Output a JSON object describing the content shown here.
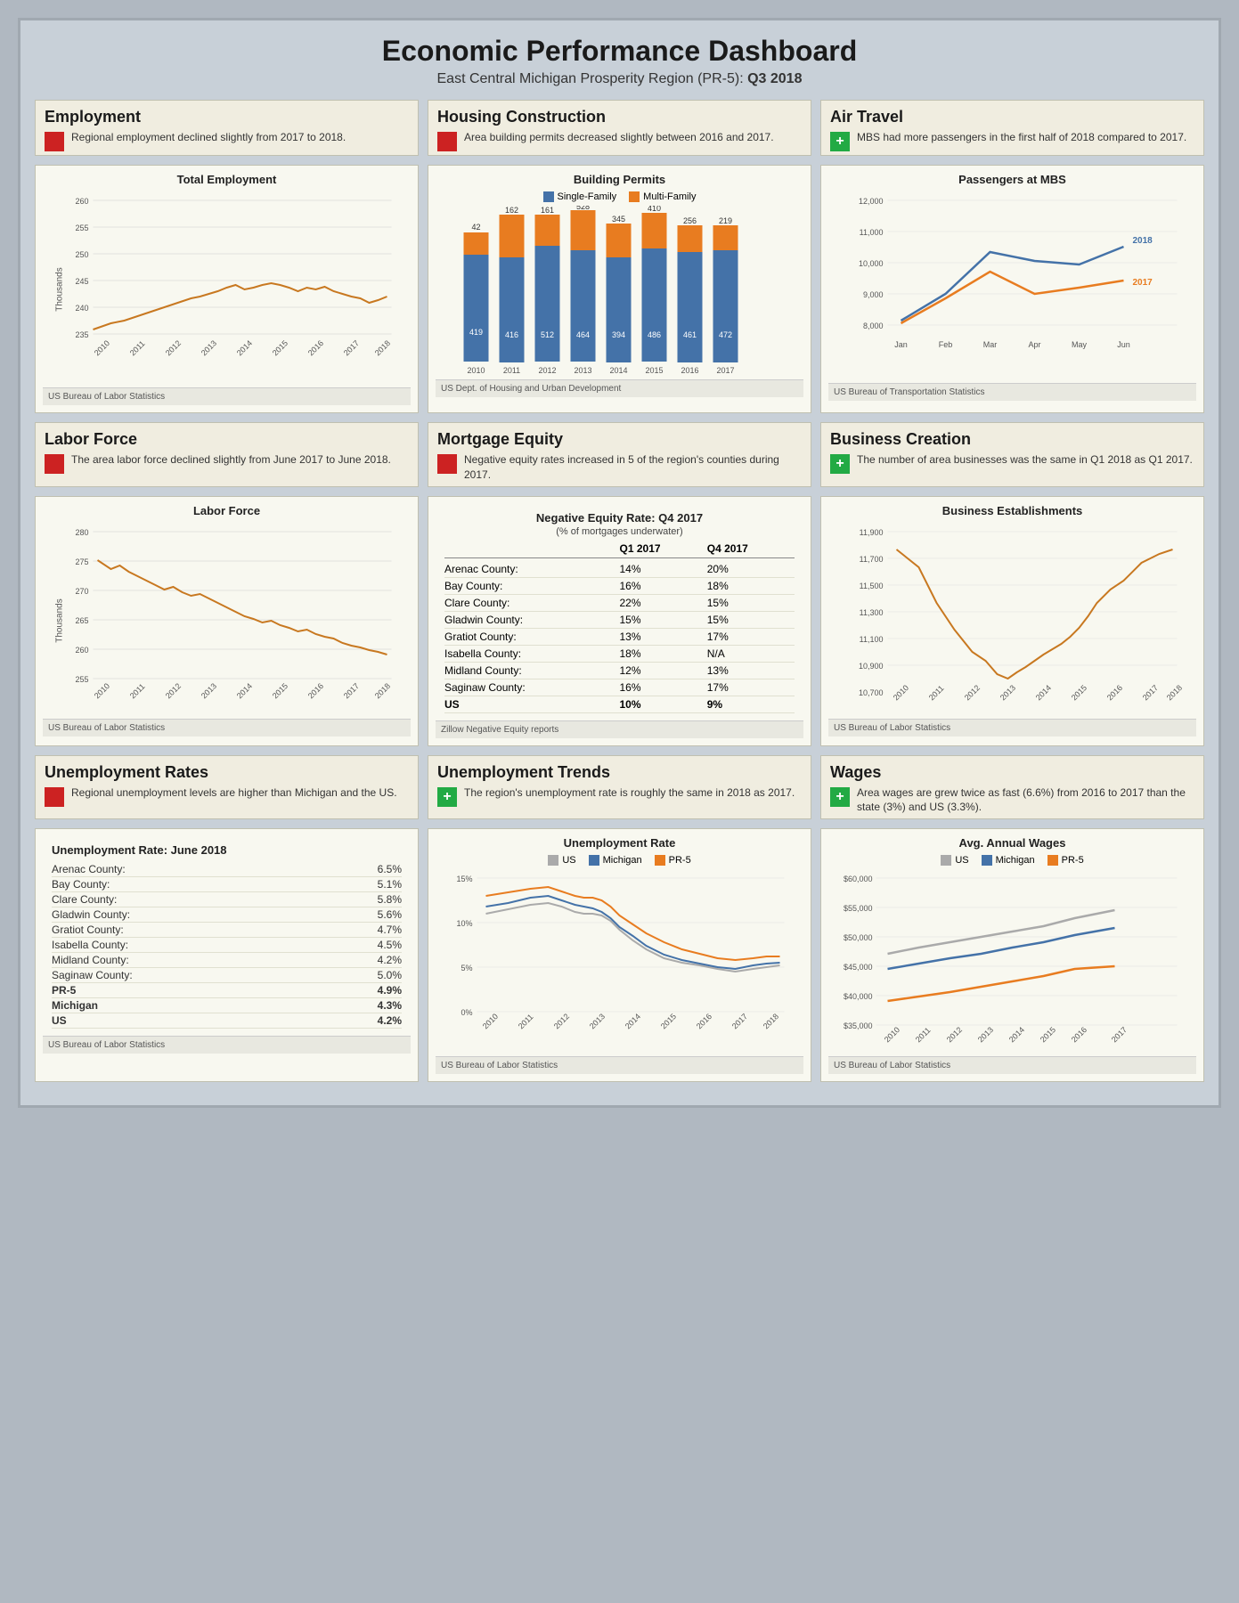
{
  "header": {
    "title": "Economic Performance Dashboard",
    "subtitle": "East Central Michigan Prosperity Region (PR-5):",
    "period": "Q3 2018"
  },
  "sections": {
    "employment": {
      "title": "Employment",
      "indicator": "red",
      "description": "Regional employment declined slightly from 2017 to 2018.",
      "chart_title": "Total Employment",
      "source": "US Bureau of Labor Statistics"
    },
    "housing": {
      "title": "Housing Construction",
      "indicator": "red",
      "description": "Area building permits decreased slightly between 2016 and 2017.",
      "chart_title": "Building Permits",
      "source": "US Dept. of Housing and Urban Development"
    },
    "air_travel": {
      "title": "Air Travel",
      "indicator": "green",
      "description": "MBS had more passengers in the first half of 2018 compared to 2017.",
      "chart_title": "Passengers at MBS",
      "source": "US Bureau of Transportation Statistics"
    },
    "labor_force": {
      "title": "Labor Force",
      "indicator": "red",
      "description": "The area labor force declined slightly from June 2017 to June 2018.",
      "chart_title": "Labor Force",
      "source": "US Bureau of Labor Statistics"
    },
    "mortgage": {
      "title": "Mortgage Equity",
      "indicator": "red",
      "description": "Negative equity rates increased in 5 of the region's counties during 2017.",
      "chart_title": "Negative Equity Rate: Q4 2017",
      "chart_subtitle": "(% of mortgages underwater)",
      "source": "Zillow Negative Equity reports"
    },
    "business": {
      "title": "Business Creation",
      "indicator": "green",
      "description": "The number of area businesses was the same in Q1 2018 as Q1 2017.",
      "chart_title": "Business Establishments",
      "source": "US Bureau of Labor Statistics"
    },
    "unemployment_rates": {
      "title": "Unemployment Rates",
      "indicator": "red",
      "description": "Regional unemployment levels are higher than Michigan and the US.",
      "chart_title": "Unemployment Rate: June 2018",
      "source": "US Bureau of Labor Statistics",
      "counties": [
        {
          "name": "Arenac County:",
          "value": "6.5%"
        },
        {
          "name": "Bay County:",
          "value": "5.1%"
        },
        {
          "name": "Clare County:",
          "value": "5.8%"
        },
        {
          "name": "Gladwin County:",
          "value": "5.6%"
        },
        {
          "name": "Gratiot County:",
          "value": "4.7%"
        },
        {
          "name": "Isabella County:",
          "value": "4.5%"
        },
        {
          "name": "Midland County:",
          "value": "4.2%"
        },
        {
          "name": "Saginaw County:",
          "value": "5.0%"
        },
        {
          "name": "PR-5",
          "value": "4.9%",
          "bold": true
        },
        {
          "name": "Michigan",
          "value": "4.3%",
          "bold": true
        },
        {
          "name": "US",
          "value": "4.2%",
          "bold": true
        }
      ]
    },
    "unemployment_trends": {
      "title": "Unemployment Trends",
      "indicator": "green",
      "description": "The region's unemployment rate is roughly the same in 2018 as 2017.",
      "chart_title": "Unemployment Rate",
      "source": "US Bureau of Labor Statistics"
    },
    "wages": {
      "title": "Wages",
      "indicator": "green",
      "description": "Area wages are grew twice as fast (6.6%) from 2016 to 2017 than the state (3%) and US (3.3%).",
      "chart_title": "Avg. Annual Wages",
      "source": "US Bureau of Labor Statistics"
    }
  },
  "equity_table": {
    "headers": [
      "",
      "Q1 2017",
      "Q4 2017"
    ],
    "rows": [
      {
        "county": "Arenac County:",
        "q1": "14%",
        "q4": "20%"
      },
      {
        "county": "Bay County:",
        "q1": "16%",
        "q4": "18%"
      },
      {
        "county": "Clare County:",
        "q1": "22%",
        "q4": "15%"
      },
      {
        "county": "Gladwin County:",
        "q1": "15%",
        "q4": "15%"
      },
      {
        "county": "Gratiot County:",
        "q1": "13%",
        "q4": "17%"
      },
      {
        "county": "Isabella County:",
        "q1": "18%",
        "q4": "N/A"
      },
      {
        "county": "Midland County:",
        "q1": "12%",
        "q4": "13%"
      },
      {
        "county": "Saginaw County:",
        "q1": "16%",
        "q4": "17%"
      },
      {
        "county": "US",
        "q1": "10%",
        "q4": "9%",
        "bold": true
      }
    ]
  }
}
